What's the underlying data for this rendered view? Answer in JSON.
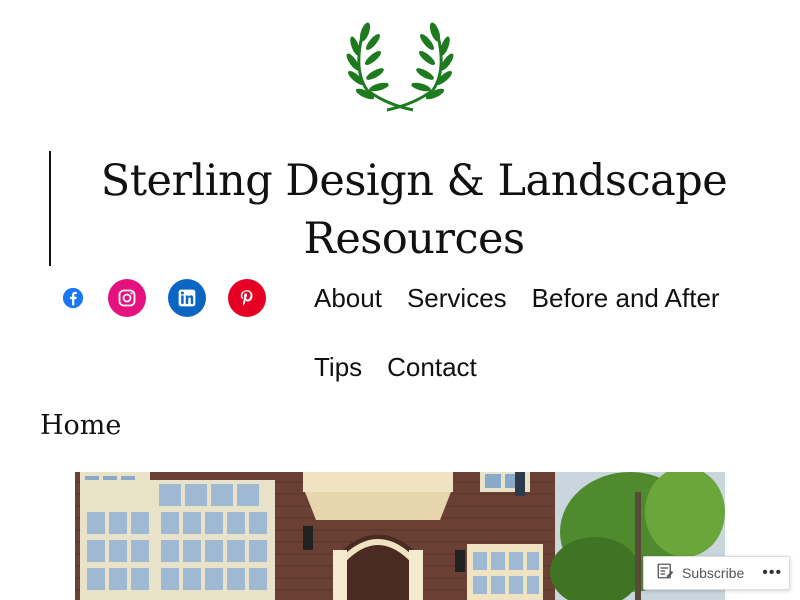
{
  "site": {
    "title": "Sterling Design & Landscape Resources",
    "brand_color": "#1e7a1e"
  },
  "social": [
    {
      "name": "facebook-icon",
      "color": "#1877f2"
    },
    {
      "name": "instagram-icon",
      "color": "#e4117f"
    },
    {
      "name": "linkedin-icon",
      "color": "#0a66c2"
    },
    {
      "name": "pinterest-icon",
      "color": "#e60023"
    }
  ],
  "nav": {
    "items": [
      "About",
      "Services",
      "Before and After",
      "Tips",
      "Contact"
    ]
  },
  "page": {
    "heading": "Home"
  },
  "hero": {
    "icon": "house-photo"
  },
  "subscribe": {
    "label": "Subscribe",
    "more": "•••"
  }
}
